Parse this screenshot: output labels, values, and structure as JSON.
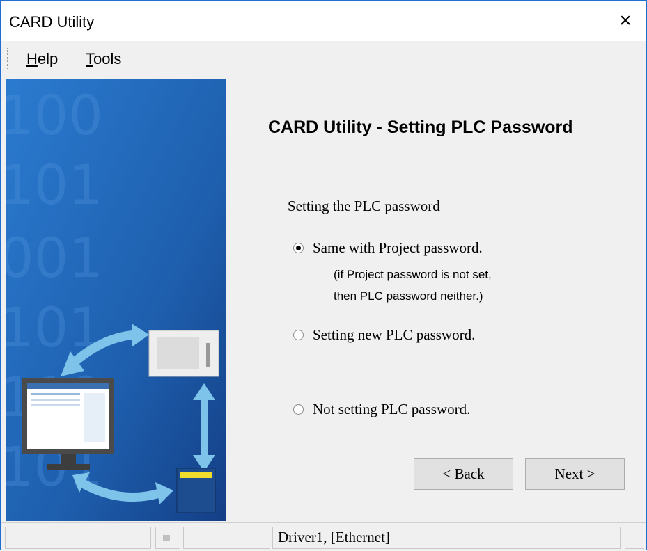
{
  "window": {
    "title": "CARD Utility",
    "close_icon": "close-icon",
    "close_glyph": "×"
  },
  "menu": {
    "items": [
      {
        "label": "Help",
        "mnemonic": "H"
      },
      {
        "label": "Tools",
        "mnemonic": "T"
      }
    ]
  },
  "wizard": {
    "heading": "CARD Utility - Setting PLC Password",
    "group_label": "Setting the PLC password",
    "options": [
      {
        "label": "Same with Project password.",
        "checked": true
      },
      {
        "label": "Setting new PLC password.",
        "checked": false
      },
      {
        "label": "Not setting PLC password.",
        "checked": false
      }
    ],
    "note_lines": [
      "(if Project password is not set,",
      "then PLC password neither.)"
    ],
    "back_label": "< Back",
    "next_label": "Next >"
  },
  "status": {
    "driver_text": "Driver1, [Ethernet]"
  },
  "colors": {
    "window_border": "#1e6fd0",
    "panel_bg": "#f0f0f0",
    "illustration_blue": "#1f63b0",
    "arrow_blue": "#7ec3ea"
  }
}
